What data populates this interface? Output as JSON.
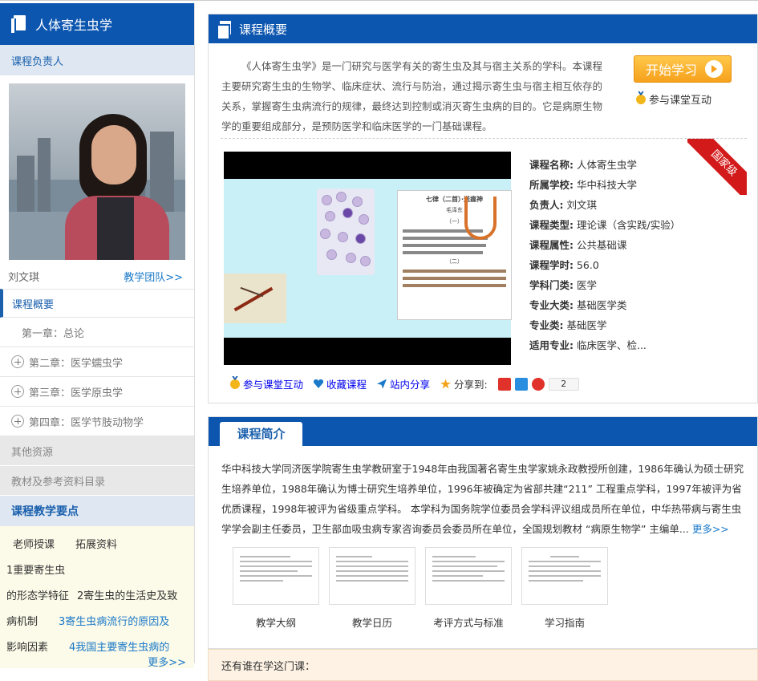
{
  "sidebar": {
    "course_title": "人体寄生虫学",
    "instructor_heading": "课程负责人",
    "instructor_name": "刘文琪",
    "team_link": "教学团队>>",
    "nav": {
      "overview": "课程概要",
      "chapters": [
        {
          "label": "第一章：总论",
          "expandable": false
        },
        {
          "label": "第二章：医学蠕虫学",
          "expandable": true
        },
        {
          "label": "第三章：医学原虫学",
          "expandable": true
        },
        {
          "label": "第四章：医学节肢动物学",
          "expandable": true
        }
      ],
      "other_resources": "其他资源",
      "textbook_list": "教材及参考资料目录"
    },
    "key_points": {
      "title": "课程教学要点",
      "items": [
        "老师授课",
        "拓展资料",
        "1重要寄生虫",
        "的形态学特征",
        "2寄生虫的生活史及致",
        "病机制",
        "3寄生虫病流行的原因及",
        "影响因素",
        "4我国主要寄生虫病的"
      ],
      "more": "更多>>"
    }
  },
  "overview_panel": {
    "title": "课程概要",
    "description": "《人体寄生虫学》是一门研究与医学有关的寄生虫及其与宿主关系的学科。本课程主要研究寄生虫的生物学、临床症状、流行与防治，通过揭示寄生虫与宿主相互依存的关系，掌握寄生虫病流行的规律，最终达到控制或消灭寄生虫病的目的。它是病原生物学的重要组成部分，是预防医学和临床医学的一门基础课程。",
    "start_button": "开始学习",
    "interact_link": "参与课堂互动",
    "badge": "国家级",
    "video": {
      "poem_title": "七律（二首）·送瘟神",
      "poem_author": "毛泽东",
      "poem_part1": "（一）",
      "poem_part2": "（二）"
    },
    "info": [
      {
        "key": "课程名称:",
        "value": "人体寄生虫学"
      },
      {
        "key": "所属学校:",
        "value": "华中科技大学"
      },
      {
        "key": "负责人:",
        "value": "刘文琪"
      },
      {
        "key": "课程类型:",
        "value": "理论课（含实践/实验）"
      },
      {
        "key": "课程属性:",
        "value": "公共基础课"
      },
      {
        "key": "课程学时:",
        "value": "56.0"
      },
      {
        "key": "学科门类:",
        "value": "医学"
      },
      {
        "key": "专业大类:",
        "value": "基础医学类"
      },
      {
        "key": "专业类:",
        "value": "基础医学"
      },
      {
        "key": "适用专业:",
        "value": "临床医学、检..."
      }
    ],
    "actions": {
      "interact": "参与课堂互动",
      "favorite": "收藏课程",
      "site_share": "站内分享",
      "share_to": "分享到:",
      "share_count": "2"
    }
  },
  "intro_panel": {
    "tab": "课程简介",
    "text": "华中科技大学同济医学院寄生虫学教研室于1948年由我国著名寄生虫学家姚永政教授所创建，1986年确认为硕士研究生培养单位，1988年确认为博士研究生培养单位，1996年被确定为省部共建“211” 工程重点学科，1997年被评为省优质课程，1998年被评为省级重点学科。 本学科为国务院学位委员会学科评议组成员所在单位，中华热带病与寄生虫学学会副主任委员，卫生部血吸虫病专家咨询委员会委员所在单位，全国规划教材 “病原生物学” 主编单...",
    "more": "更多>>",
    "docs": [
      "教学大纲",
      "教学日历",
      "考评方式与标准",
      "学习指南"
    ]
  },
  "bottom_panel": {
    "text": "还有谁在学这门课："
  },
  "colors": {
    "primary": "#0d56b0",
    "link": "#1a79c9",
    "start_button": "#f6a11c",
    "badge": "#d31a1a"
  }
}
